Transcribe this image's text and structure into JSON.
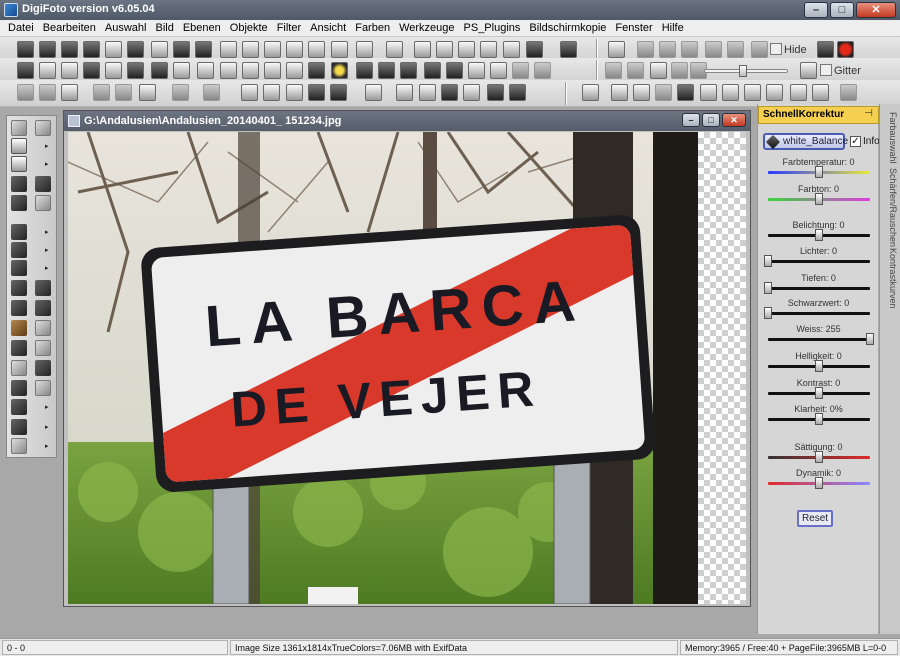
{
  "window": {
    "title": "DigiFoto version v6.05.04",
    "min": "–",
    "max": "□",
    "close": "✕"
  },
  "menu": [
    "Datei",
    "Bearbeiten",
    "Auswahl",
    "Bild",
    "Ebenen",
    "Objekte",
    "Filter",
    "Ansicht",
    "Farben",
    "Werkzeuge",
    "PS_Plugins",
    "Bildschirmkopie",
    "Fenster",
    "Hilfe"
  ],
  "toolbar": {
    "hide_label": "Hide",
    "gitter_label": "Gitter"
  },
  "image_window": {
    "title": "G:\\Andalusien\\Andalusien_20140401_ 151234.jpg",
    "sign_line1": "LA BARCA",
    "sign_line2": "DE VEJER"
  },
  "panel": {
    "title": "SchnellKorrektur",
    "pin": "⊣",
    "wb_label": "white_Balance",
    "info_label": "Info",
    "info_checked": "✓",
    "sliders": [
      {
        "label": "Farbtemperatur: 0",
        "value": 0.5
      },
      {
        "label": "Farbton: 0",
        "value": 0.5
      },
      {
        "label": "Belichtung: 0",
        "value": 0.5
      },
      {
        "label": "Lichter: 0",
        "value": 0.0
      },
      {
        "label": "Tiefen: 0",
        "value": 0.0
      },
      {
        "label": "Schwarzwert: 0",
        "value": 0.0
      },
      {
        "label": "Weiss: 255",
        "value": 1.0
      },
      {
        "label": "Helligkeit: 0",
        "value": 0.5
      },
      {
        "label": "Kontrast: 0",
        "value": 0.5
      },
      {
        "label": "Klarheit: 0%",
        "value": 0.5
      },
      {
        "label": "Sättigung: 0",
        "value": 0.5
      },
      {
        "label": "Dynamik: 0",
        "value": 0.5
      }
    ],
    "reset_label": "Reset"
  },
  "side_tabs": [
    "Farbauswahl",
    "Schärfen/Rauschen",
    "Kontrastkurven"
  ],
  "status": {
    "coords": "0 - 0",
    "image_info": "Image Size 1361x1814xTrueColors=7.06MB  with ExifData",
    "memory": "Memory:3965 / Free:40 + PageFile:3965MB L=0-0"
  }
}
